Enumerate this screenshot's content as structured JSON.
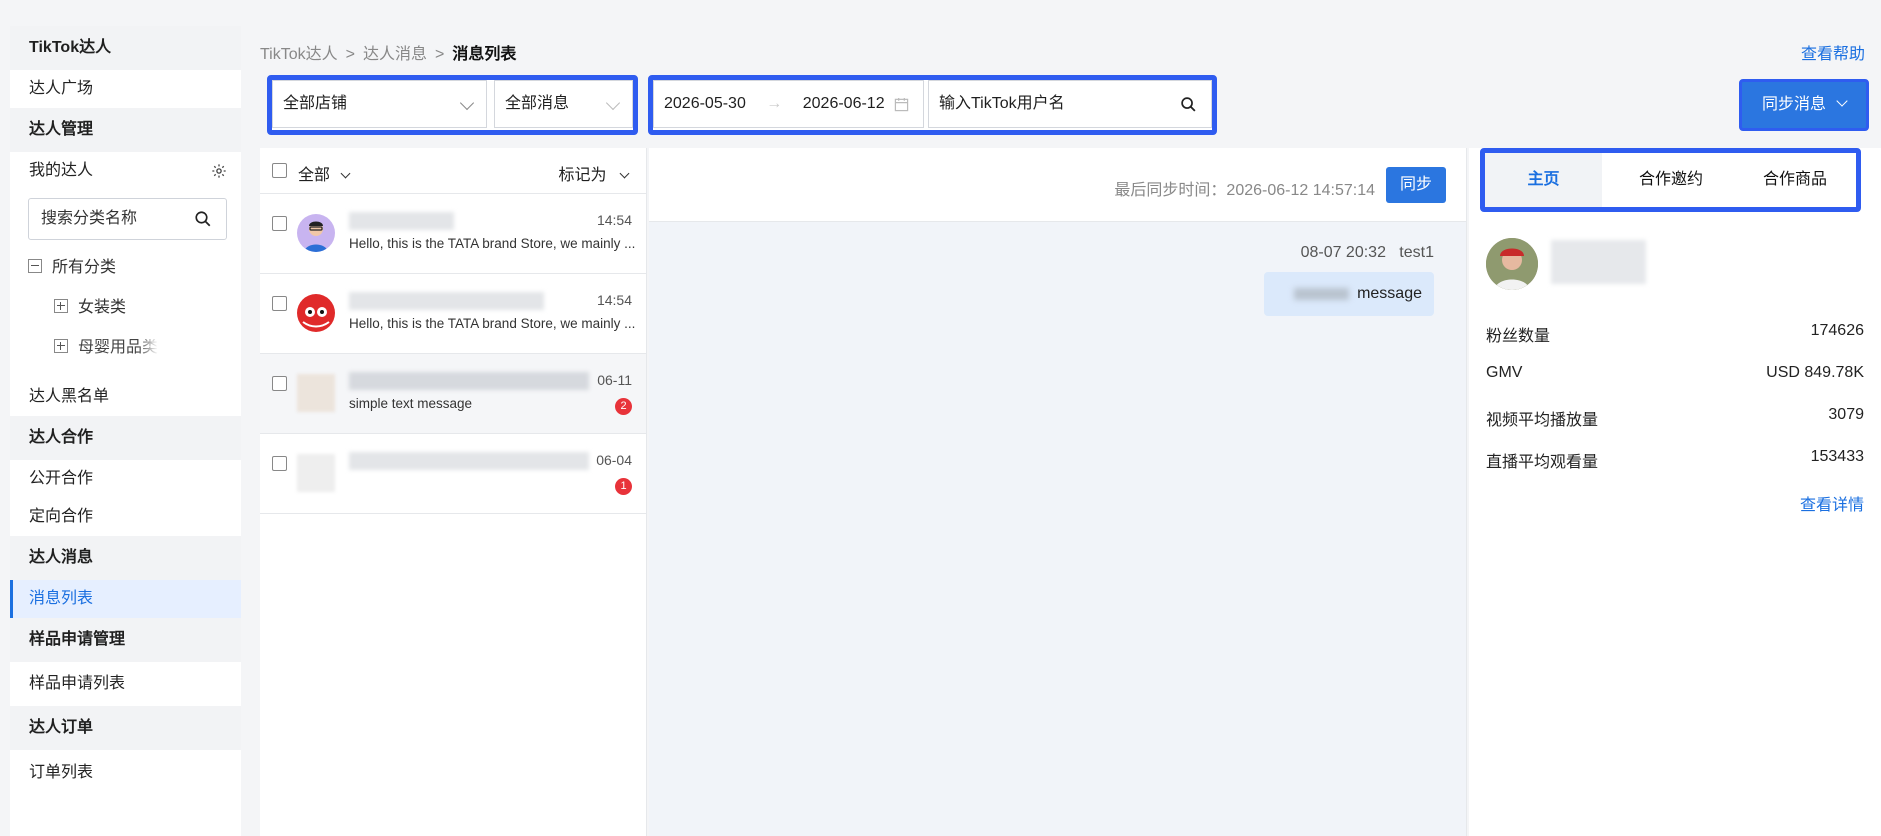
{
  "sidebar": {
    "app_title": "TikTok达人",
    "square": "达人广场",
    "manage": "达人管理",
    "my_talents": "我的达人",
    "search_placeholder": "搜索分类名称",
    "all_categories": "所有分类",
    "cat_womens": "女装类",
    "cat_baby": "母婴用品类",
    "blacklist": "达人黑名单",
    "cooperation": "达人合作",
    "public_coop": "公开合作",
    "targeted_coop": "定向合作",
    "messages": "达人消息",
    "message_list": "消息列表",
    "sample_mgmt": "样品申请管理",
    "sample_list": "样品申请列表",
    "orders": "达人订单",
    "order_list": "订单列表"
  },
  "breadcrumb": {
    "level1": "TikTok达人",
    "level2": "达人消息",
    "current": "消息列表",
    "sep": ">"
  },
  "help_link": "查看帮助",
  "filters": {
    "store": "全部店铺",
    "message_type": "全部消息",
    "date_start": "2026-05-30",
    "date_arrow": "→",
    "date_end": "2026-06-12",
    "username_placeholder": "输入TikTok用户名"
  },
  "sync_button": "同步消息",
  "list": {
    "select_all": "全部",
    "mark_as": "标记为",
    "items": [
      {
        "time": "14:54",
        "text": "Hello, this is the TATA brand Store, we mainly ...",
        "badge": ""
      },
      {
        "time": "14:54",
        "text": "Hello, this is the TATA brand Store, we mainly ...",
        "badge": ""
      },
      {
        "time": "06-11",
        "text": "simple text message",
        "badge": "2"
      },
      {
        "time": "06-04",
        "text": "",
        "badge": "1"
      }
    ]
  },
  "chat": {
    "last_sync": "最后同步时间：2026-06-12 14:57:14",
    "sync_btn": "同步",
    "message_meta": "08-07 20:32   test1",
    "message_text": "message"
  },
  "profile": {
    "tabs": [
      "主页",
      "合作邀约",
      "合作商品"
    ],
    "stats": [
      {
        "label": "粉丝数量",
        "value": "174626"
      },
      {
        "label": "GMV",
        "value": "USD 849.78K"
      },
      {
        "label": "视频平均播放量",
        "value": "3079"
      },
      {
        "label": "直播平均观看量",
        "value": "153433"
      }
    ],
    "detail_link": "查看详情"
  },
  "colors": {
    "accent": "#1a6fe0",
    "highlight": "#2f5cf0",
    "badge": "#e8333a"
  }
}
